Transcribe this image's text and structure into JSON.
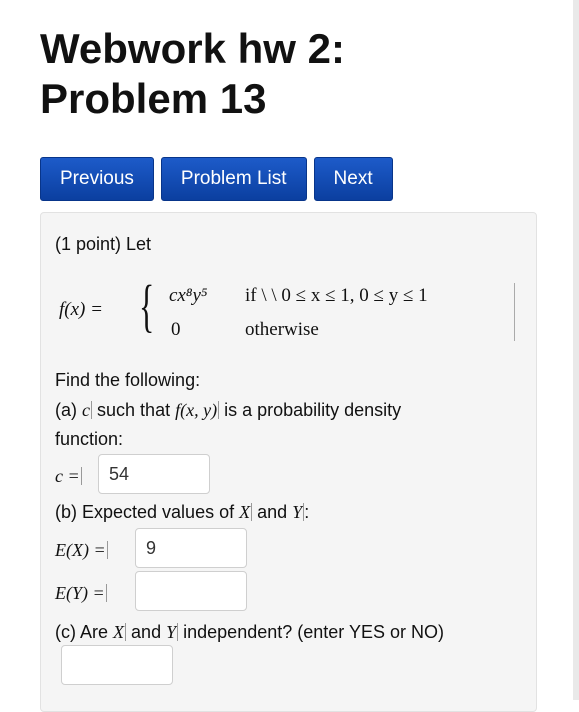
{
  "page": {
    "title_line1": "Webwork hw 2:",
    "title_line2": "Problem 13"
  },
  "nav": {
    "previous": "Previous",
    "problem_list": "Problem List",
    "next": "Next"
  },
  "problem": {
    "intro": "(1 point) Let",
    "fx_label": "f(x) =",
    "case1_expr": "cx⁸y⁵",
    "case1_cond": "if \\ \\ 0 ≤ x ≤ 1,  0 ≤ y ≤ 1",
    "case2_expr": "0",
    "case2_cond": "otherwise",
    "find": "Find the following:",
    "part_a_prefix": "(a)",
    "part_a_c": "c",
    "part_a_mid": "such that",
    "part_a_fxy": "f(x, y)",
    "part_a_suffix": "is a probability density",
    "part_a_line2": "function:",
    "c_label": "c =",
    "c_value": "54",
    "part_b_prefix": "(b) Expected values of",
    "part_b_X": "X",
    "part_b_and": "and",
    "part_b_Y": "Y",
    "part_b_colon": ":",
    "ex_label": "E(X) =",
    "ex_value": "9",
    "ey_label": "E(Y) =",
    "ey_value": "",
    "part_c_prefix": "(c) Are",
    "part_c_X": "X",
    "part_c_and": "and",
    "part_c_Y": "Y",
    "part_c_suffix": "independent? (enter YES or NO)",
    "indep_value": ""
  }
}
